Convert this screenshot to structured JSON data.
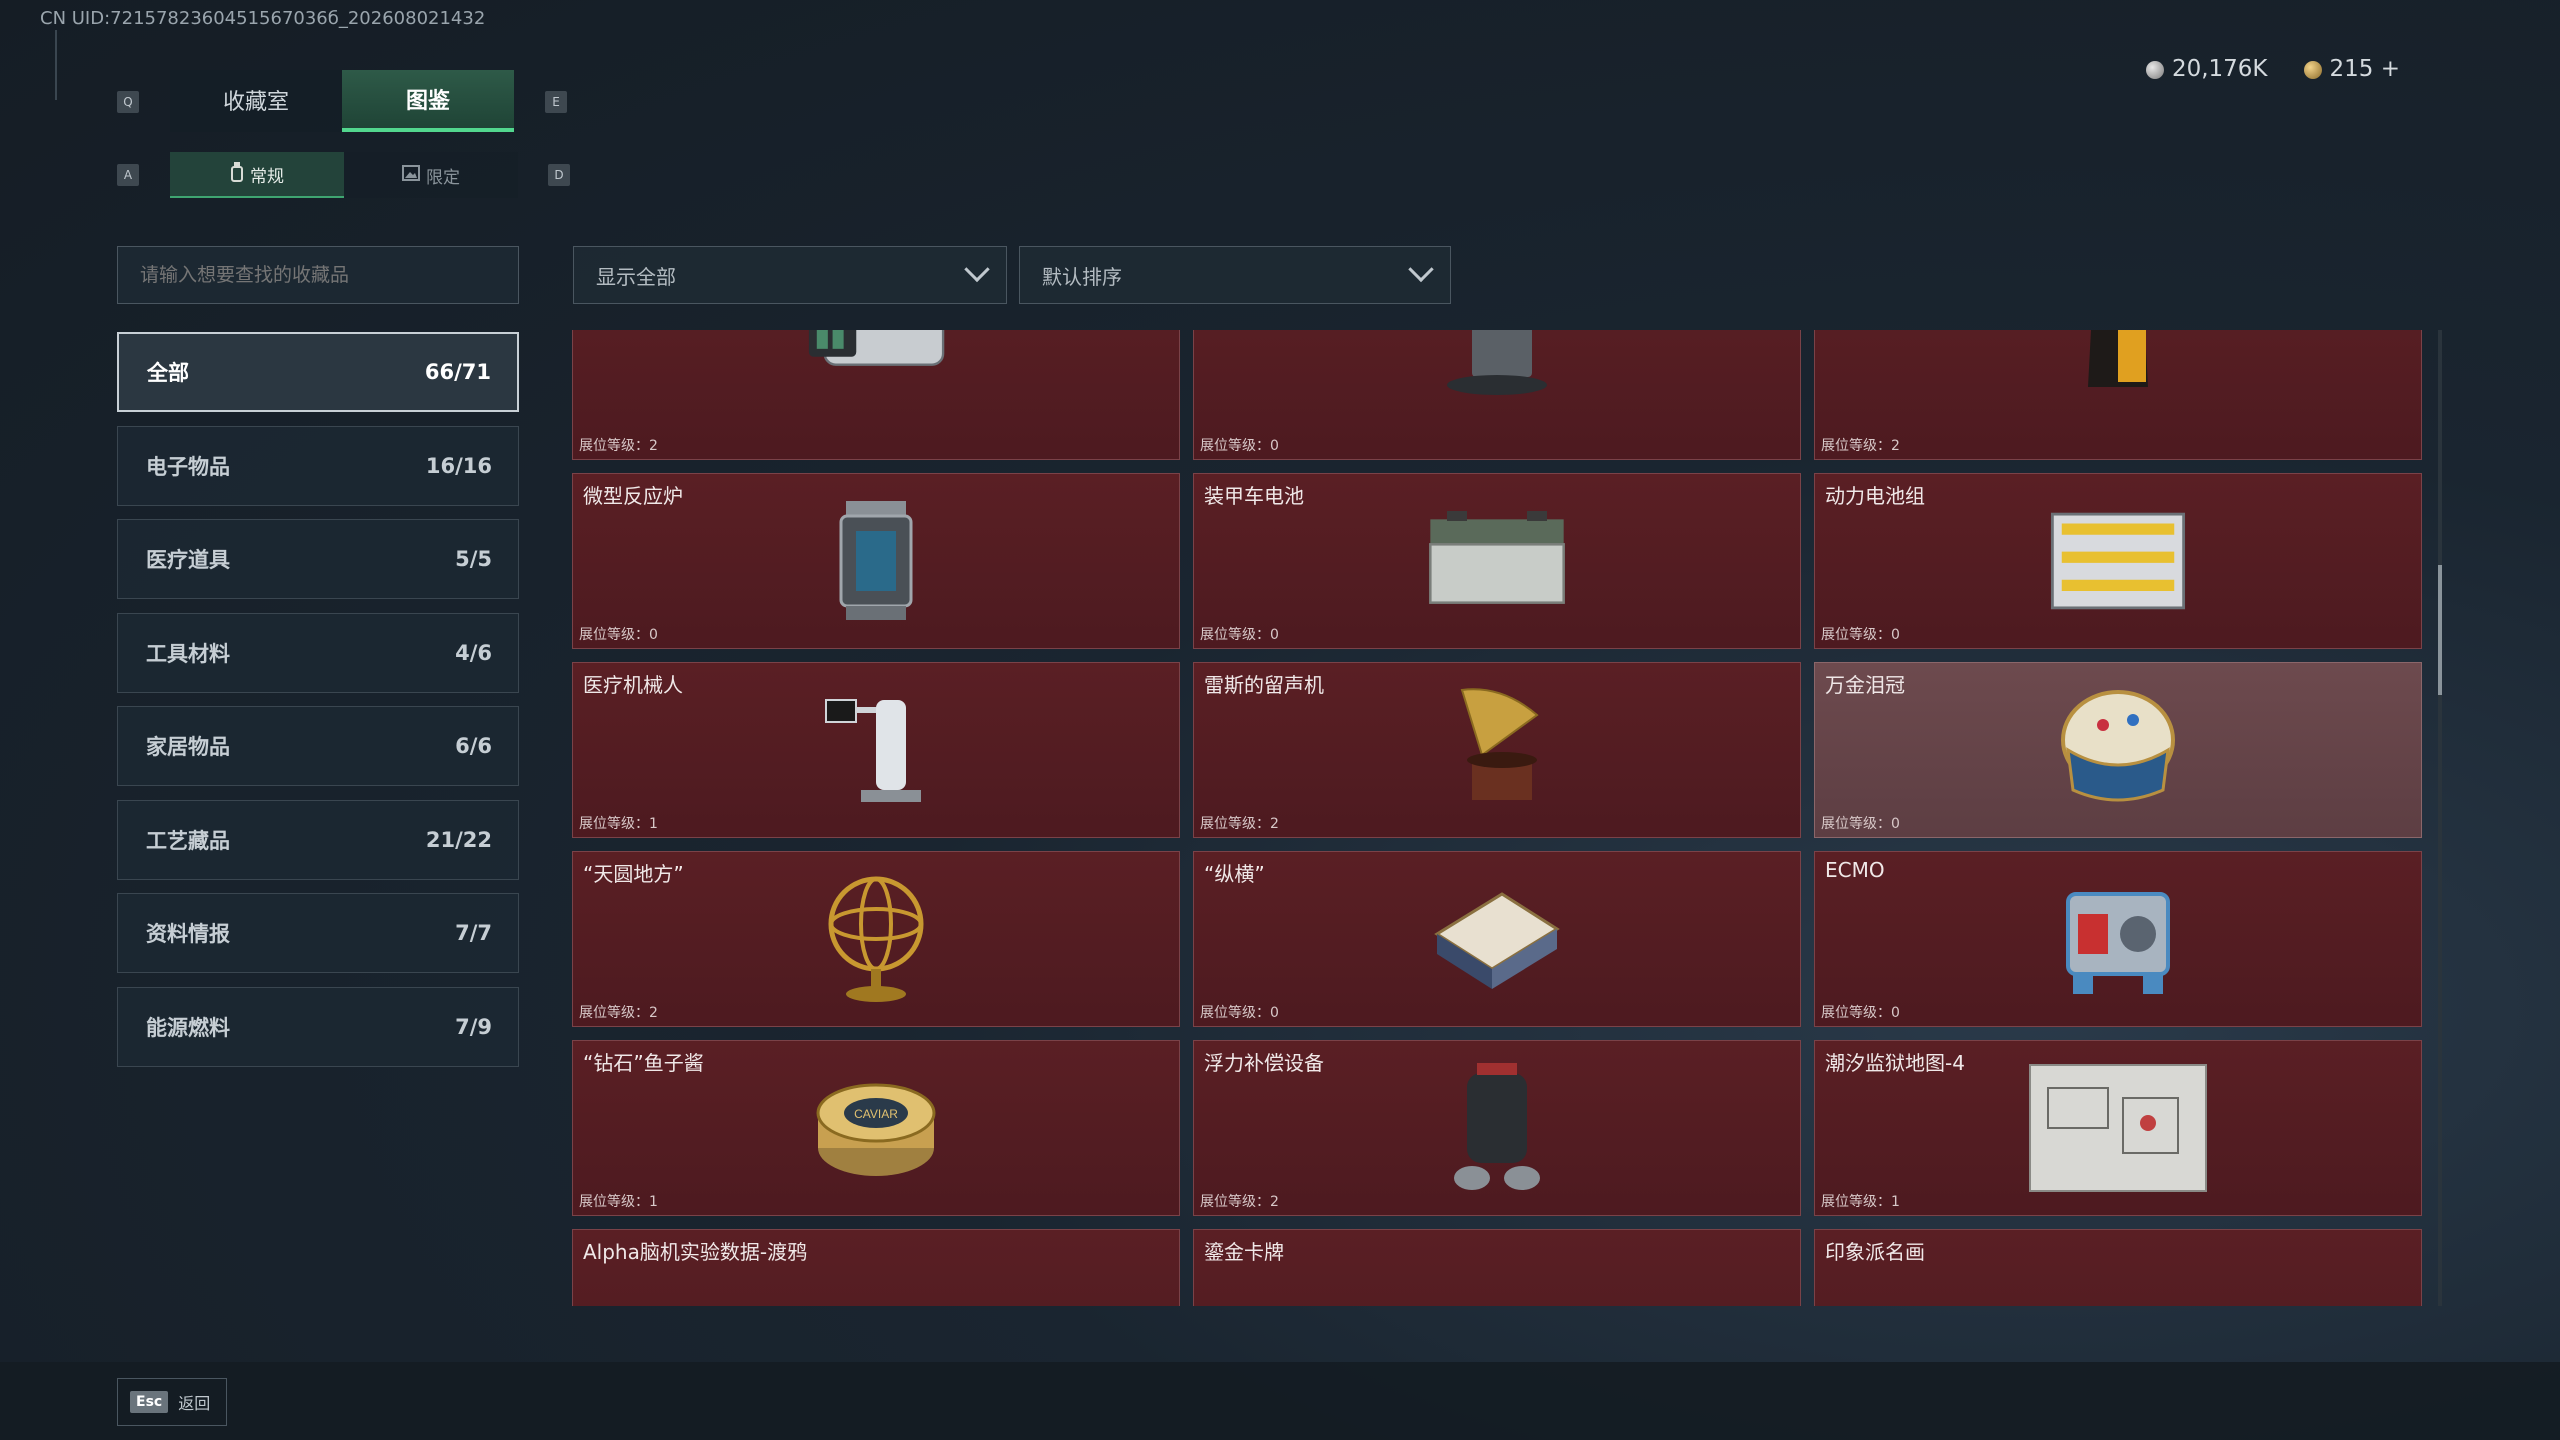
{
  "uid": "CN UID:7215782360451567036б_202608021432",
  "top_tabs": [
    {
      "label": "收藏室"
    },
    {
      "label": "图鉴"
    }
  ],
  "sub_tabs": [
    {
      "label": "常规"
    },
    {
      "label": "限定"
    }
  ],
  "keys": {
    "q": "Q",
    "e": "E",
    "a": "A",
    "d": "D"
  },
  "currency": {
    "silver": "20,176K",
    "gold": "215 +"
  },
  "search": {
    "placeholder": "请输入想要查找的收藏品"
  },
  "filters": {
    "show": "显示全部",
    "sort": "默认排序"
  },
  "categories": [
    {
      "label": "全部",
      "count": "66/71"
    },
    {
      "label": "电子物品",
      "count": "16/16"
    },
    {
      "label": "医疗道具",
      "count": "5/5"
    },
    {
      "label": "工具材料",
      "count": "4/6"
    },
    {
      "label": "家居物品",
      "count": "6/6"
    },
    {
      "label": "工艺藏品",
      "count": "21/22"
    },
    {
      "label": "资料情报",
      "count": "7/7"
    },
    {
      "label": "能源燃料",
      "count": "7/9"
    }
  ],
  "items": [
    {
      "name": "",
      "level": "展位等级：2",
      "icon": "camera-icon"
    },
    {
      "name": "",
      "level": "展位等级：0",
      "icon": "robot-vacuum-icon"
    },
    {
      "name": "",
      "level": "展位等级：2",
      "icon": "coffee-bag-icon"
    },
    {
      "name": "微型反应炉",
      "level": "展位等级：0",
      "icon": "reactor-icon"
    },
    {
      "name": "装甲车电池",
      "level": "展位等级：0",
      "icon": "battery-icon"
    },
    {
      "name": "动力电池组",
      "level": "展位等级：0",
      "icon": "battery-pack-icon"
    },
    {
      "name": "医疗机械人",
      "level": "展位等级：1",
      "icon": "medical-robot-icon"
    },
    {
      "name": "雷斯的留声机",
      "level": "展位等级：2",
      "icon": "gramophone-icon"
    },
    {
      "name": "万金泪冠",
      "level": "展位等级：0",
      "icon": "jeweled-egg-icon"
    },
    {
      "name": "“天圆地方”",
      "level": "展位等级：2",
      "icon": "armillary-sphere-icon"
    },
    {
      "name": "“纵横”",
      "level": "展位等级：0",
      "icon": "chessboard-icon"
    },
    {
      "name": "ECMO",
      "level": "展位等级：0",
      "icon": "ecmo-machine-icon"
    },
    {
      "name": "“钻石”鱼子酱",
      "level": "展位等级：1",
      "icon": "caviar-tin-icon"
    },
    {
      "name": "浮力补偿设备",
      "level": "展位等级：2",
      "icon": "bcd-gear-icon"
    },
    {
      "name": "潮汐监狱地图-4",
      "level": "展位等级：1",
      "icon": "map-icon"
    },
    {
      "name": "Alpha脑机实验数据-渡鸦",
      "level": "",
      "icon": "data-drive-icon"
    },
    {
      "name": "鎏金卡牌",
      "level": "",
      "icon": "gold-card-icon"
    },
    {
      "name": "印象派名画",
      "level": "",
      "icon": "painting-icon"
    }
  ],
  "caviar_label": "CAVIAR",
  "footer": {
    "esc": "Esc",
    "back": "返回"
  }
}
